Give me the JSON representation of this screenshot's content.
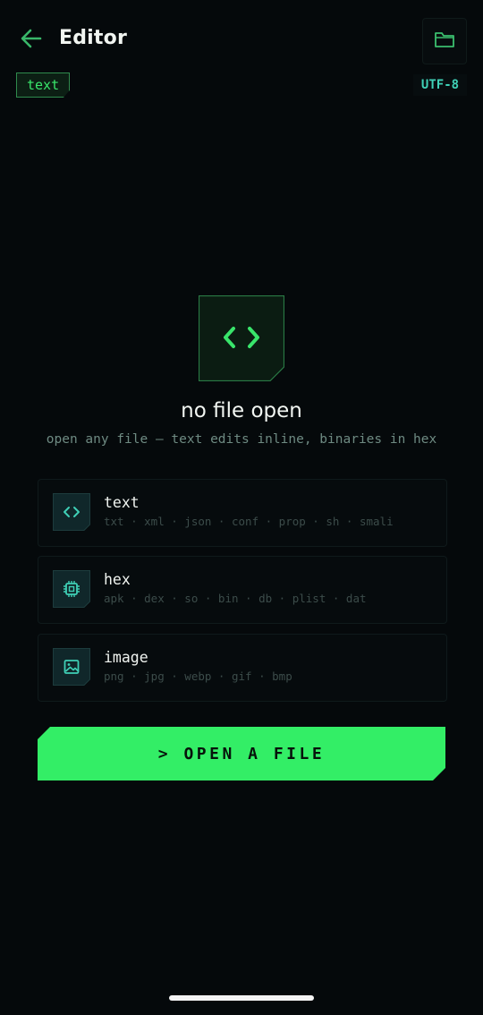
{
  "header": {
    "title": "Editor",
    "back_icon": "arrow-left-icon",
    "folder_icon": "folder-icon"
  },
  "toolbar": {
    "mode_chip": "text",
    "encoding": "UTF-8"
  },
  "empty_state": {
    "icon": "code-brackets-icon",
    "title": "no file open",
    "subtitle": "open any file — text edits inline, binaries in hex"
  },
  "file_types": [
    {
      "name": "text",
      "extensions": "txt · xml · json · conf · prop · sh · smali",
      "icon": "code-brackets-icon"
    },
    {
      "name": "hex",
      "extensions": "apk · dex · so · bin · db · plist · dat",
      "icon": "chip-icon"
    },
    {
      "name": "image",
      "extensions": "png · jpg · webp · gif · bmp",
      "icon": "image-icon"
    }
  ],
  "open_button": {
    "label": "> OPEN A FILE"
  },
  "colors": {
    "background": "#05090b",
    "accent_green": "#33ee66",
    "accent_teal": "#3fd0b6",
    "muted_text": "#6e8a82"
  }
}
